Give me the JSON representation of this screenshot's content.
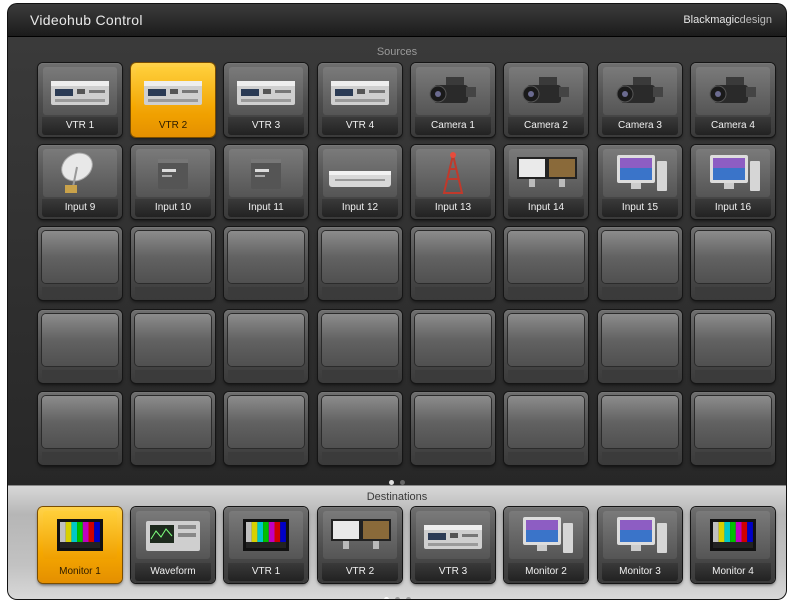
{
  "app": {
    "title": "Videohub Control",
    "brand_bold": "Blackmagic",
    "brand_light": "design"
  },
  "sources": {
    "heading": "Sources",
    "items": [
      {
        "label": "VTR 1",
        "icon": "vtr-deck-icon",
        "selected": false
      },
      {
        "label": "VTR 2",
        "icon": "vtr-deck-icon",
        "selected": true
      },
      {
        "label": "VTR 3",
        "icon": "vtr-deck-icon",
        "selected": false
      },
      {
        "label": "VTR 4",
        "icon": "vtr-deck-icon",
        "selected": false
      },
      {
        "label": "Camera 1",
        "icon": "camera-icon",
        "selected": false
      },
      {
        "label": "Camera 2",
        "icon": "camera-icon",
        "selected": false
      },
      {
        "label": "Camera 3",
        "icon": "camera-icon",
        "selected": false
      },
      {
        "label": "Camera 4",
        "icon": "camera-icon",
        "selected": false
      },
      {
        "label": "Input 9",
        "icon": "satellite-dish-icon",
        "selected": false
      },
      {
        "label": "Input 10",
        "icon": "converter-box-icon",
        "selected": false
      },
      {
        "label": "Input 11",
        "icon": "converter-box-icon",
        "selected": false
      },
      {
        "label": "Input 12",
        "icon": "router-unit-icon",
        "selected": false
      },
      {
        "label": "Input 13",
        "icon": "broadcast-tower-icon",
        "selected": false
      },
      {
        "label": "Input 14",
        "icon": "dual-monitor-icon",
        "selected": false
      },
      {
        "label": "Input 15",
        "icon": "computer-monitor-icon",
        "selected": false
      },
      {
        "label": "Input 16",
        "icon": "computer-monitor-icon",
        "selected": false
      }
    ],
    "empty_slots": 24,
    "page_dots": 2,
    "active_page": 0
  },
  "destinations": {
    "heading": "Destinations",
    "items": [
      {
        "label": "Monitor 1",
        "icon": "color-bars-monitor-icon",
        "selected": true
      },
      {
        "label": "Waveform",
        "icon": "waveform-monitor-icon",
        "selected": false
      },
      {
        "label": "VTR 1",
        "icon": "color-bars-monitor-icon",
        "selected": false
      },
      {
        "label": "VTR 2",
        "icon": "dual-monitor-icon",
        "selected": false
      },
      {
        "label": "VTR 3",
        "icon": "vtr-deck-icon",
        "selected": false
      },
      {
        "label": "Monitor 2",
        "icon": "computer-monitor-icon",
        "selected": false
      },
      {
        "label": "Monitor 3",
        "icon": "computer-monitor-icon",
        "selected": false
      },
      {
        "label": "Monitor 4",
        "icon": "color-bars-monitor-icon",
        "selected": false
      }
    ],
    "page_dots": 3,
    "active_page": 0
  },
  "colors": {
    "selected": "#f5a700",
    "tile": "#555555",
    "background": "#2a2a2a"
  }
}
